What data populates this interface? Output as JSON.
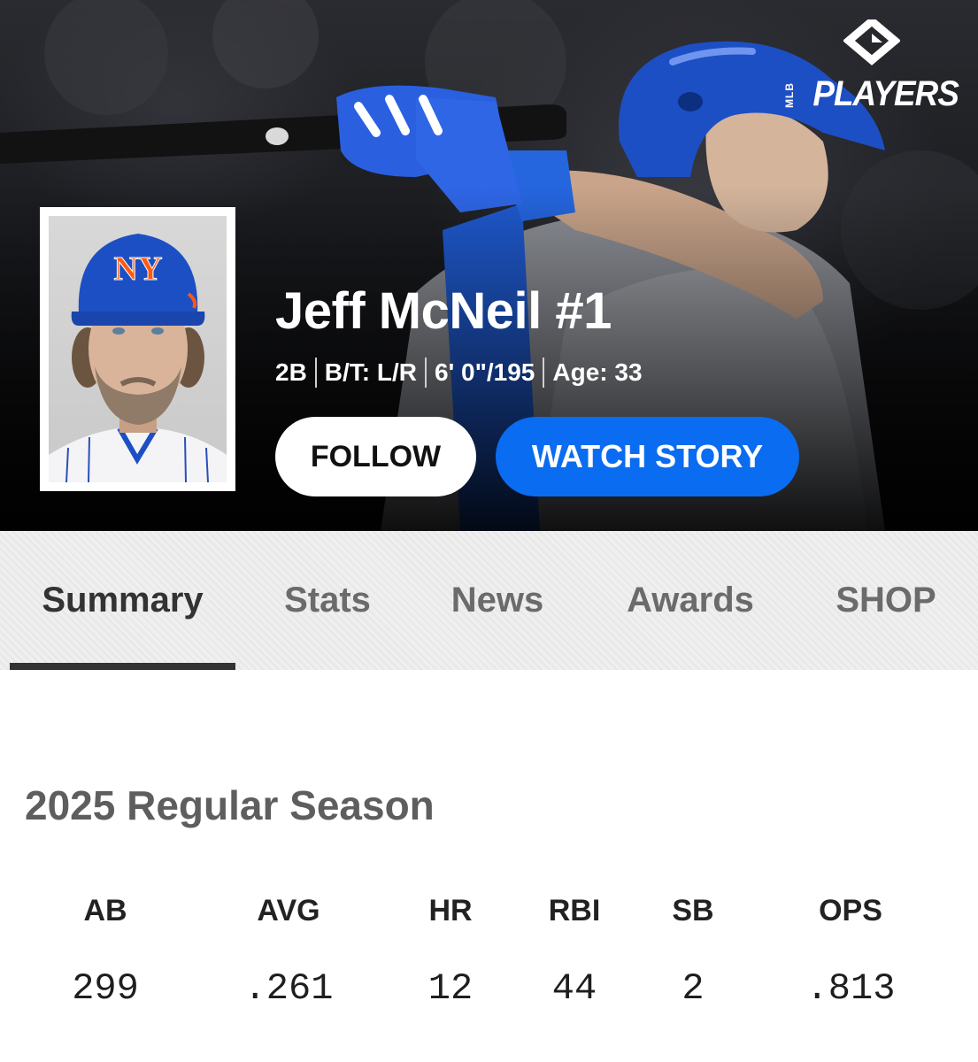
{
  "brand": {
    "league": "MLB",
    "name": "PLAYERS"
  },
  "player": {
    "name": "Jeff McNeil #1",
    "position": "2B",
    "bats_throws": "B/T: L/R",
    "height_weight": "6' 0\"/195",
    "age": "Age: 33"
  },
  "actions": {
    "follow_label": "FOLLOW",
    "watch_label": "WATCH STORY"
  },
  "tabs": [
    {
      "label": "Summary",
      "active": true
    },
    {
      "label": "Stats",
      "active": false
    },
    {
      "label": "News",
      "active": false
    },
    {
      "label": "Awards",
      "active": false
    },
    {
      "label": "SHOP",
      "active": false
    }
  ],
  "season": {
    "title": "2025 Regular Season",
    "stats": [
      {
        "label": "AB",
        "value": "299"
      },
      {
        "label": "AVG",
        "value": ".261"
      },
      {
        "label": "HR",
        "value": "12"
      },
      {
        "label": "RBI",
        "value": "44"
      },
      {
        "label": "SB",
        "value": "2"
      },
      {
        "label": "OPS",
        "value": ".813"
      }
    ]
  },
  "colors": {
    "accent": "#0a6cf0",
    "mets_blue": "#1d4fc4",
    "mets_orange": "#ff5910"
  }
}
